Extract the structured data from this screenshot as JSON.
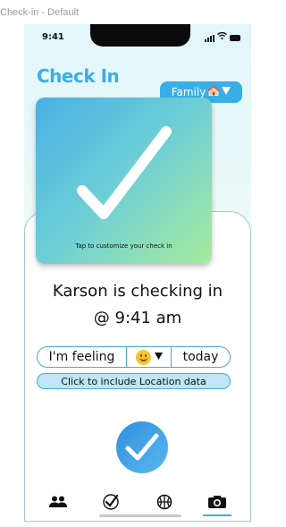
{
  "frame": {
    "label": "Check-in - Default"
  },
  "status_bar": {
    "time": "9:41"
  },
  "header": {
    "title": "Check In",
    "group_selector": {
      "value": "Family"
    }
  },
  "check_card": {
    "caption": "Tap to customize your check in"
  },
  "main": {
    "line1": "Karson is checking in",
    "line2": "@ 9:41 am",
    "feeling": {
      "prefix": "I'm feeling",
      "emoji_name": "smiley-face-icon",
      "suffix": "today"
    },
    "location_button": "Click to include Location data"
  },
  "tab_bar": {
    "tabs": [
      {
        "icon": "people-icon",
        "active": false
      },
      {
        "icon": "check-circle-icon",
        "active": false
      },
      {
        "icon": "basketball-icon",
        "active": false
      },
      {
        "icon": "camera-icon",
        "active": true
      }
    ]
  },
  "colors": {
    "accent": "#3aaee8",
    "card_gradient_start": "#49b1e3",
    "card_gradient_end": "#a7ec9c",
    "location_fill": "#bfe5f6"
  }
}
